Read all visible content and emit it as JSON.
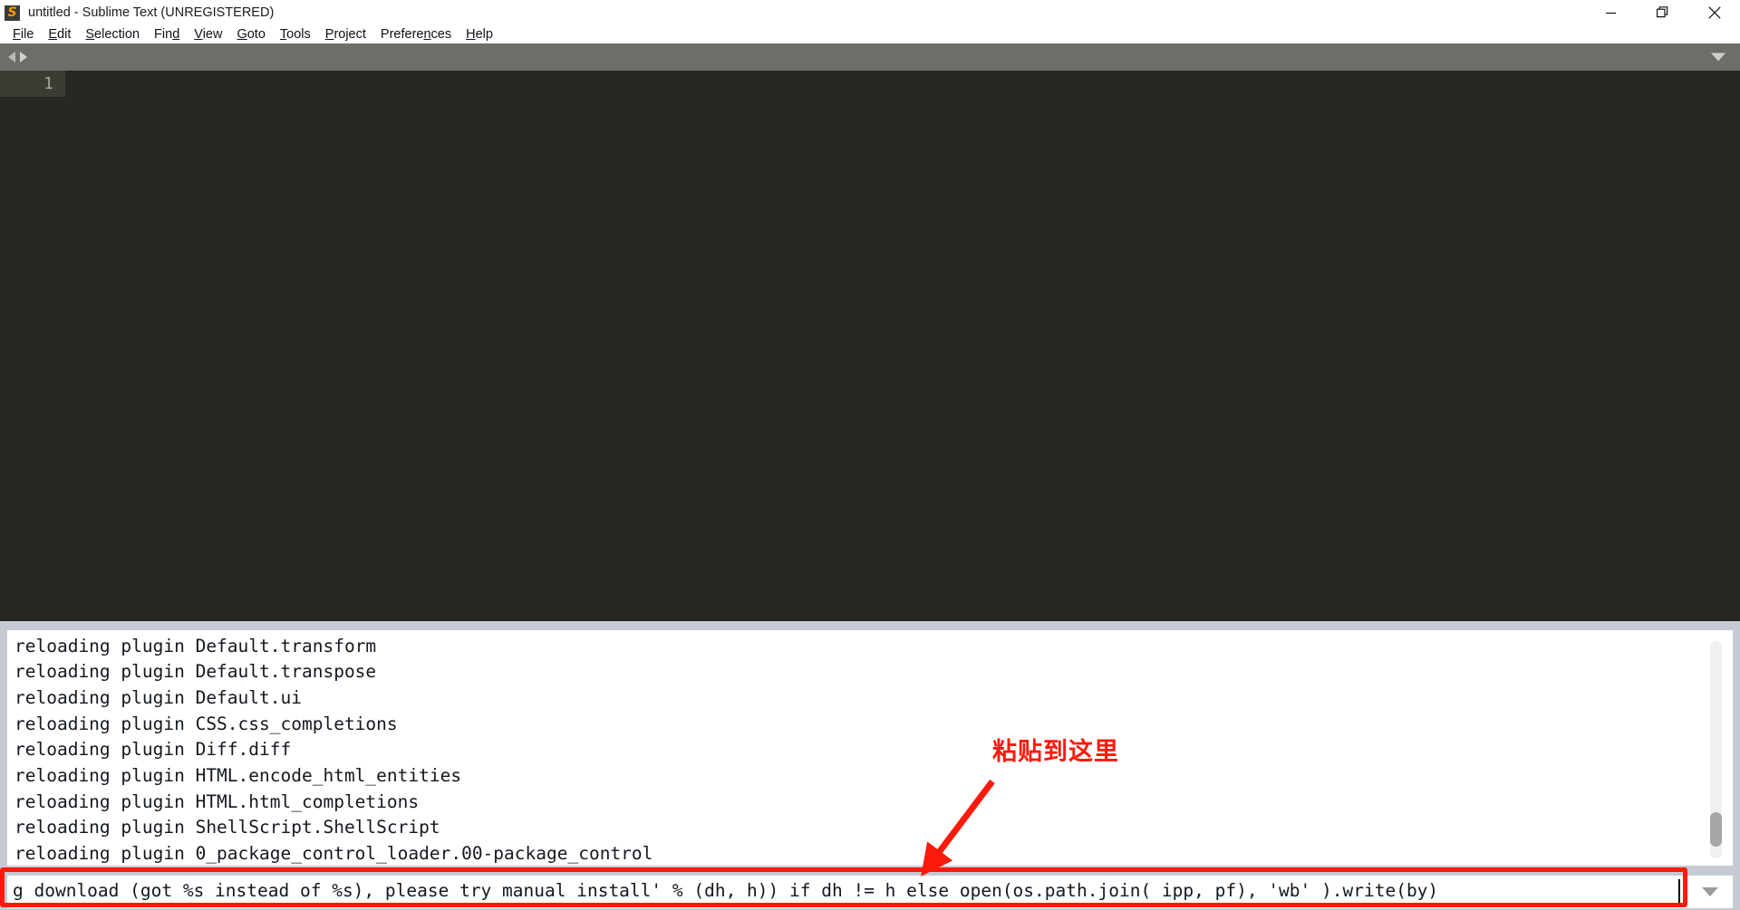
{
  "window": {
    "title": "untitled - Sublime Text (UNREGISTERED)",
    "app_icon": "sublime-text-icon",
    "controls": {
      "minimize": "minimize-icon",
      "maximize": "maximize-restore-icon",
      "close": "close-icon"
    }
  },
  "menubar": {
    "items": [
      {
        "label": "File",
        "mnemonic_index": 0
      },
      {
        "label": "Edit",
        "mnemonic_index": 0
      },
      {
        "label": "Selection",
        "mnemonic_index": 0
      },
      {
        "label": "Find",
        "mnemonic_index": 3
      },
      {
        "label": "View",
        "mnemonic_index": 0
      },
      {
        "label": "Goto",
        "mnemonic_index": 0
      },
      {
        "label": "Tools",
        "mnemonic_index": 0
      },
      {
        "label": "Project",
        "mnemonic_index": 0
      },
      {
        "label": "Preferences",
        "mnemonic_index": 7
      },
      {
        "label": "Help",
        "mnemonic_index": 0
      }
    ]
  },
  "tabbar": {
    "nav_prev_icon": "arrow-left-icon",
    "nav_next_icon": "arrow-right-icon",
    "overflow_icon": "chevron-down-icon"
  },
  "editor": {
    "line_numbers": [
      "1"
    ],
    "content": "",
    "background_color": "#272822",
    "gutter_color": "#3c3c34"
  },
  "console": {
    "output_lines": [
      "reloading plugin Default.transform",
      "reloading plugin Default.transpose",
      "reloading plugin Default.ui",
      "reloading plugin CSS.css_completions",
      "reloading plugin Diff.diff",
      "reloading plugin HTML.encode_html_entities",
      "reloading plugin HTML.html_completions",
      "reloading plugin ShellScript.ShellScript",
      "reloading plugin 0_package_control_loader.00-package_control"
    ],
    "scrollbar": "vertical-scrollbar",
    "input": {
      "value": "g download (got %s instead of %s), please try manual install' % (dh, h)) if dh != h else open(os.path.join( ipp, pf), 'wb' ).write(by)",
      "placeholder": "",
      "dropdown_icon": "chevron-down-icon"
    }
  },
  "annotation": {
    "text": "粘贴到这里",
    "color": "#fb1a0c",
    "arrow": "red-arrow-pointing-to-console-input",
    "highlight": "red-rectangle-around-console-input"
  }
}
